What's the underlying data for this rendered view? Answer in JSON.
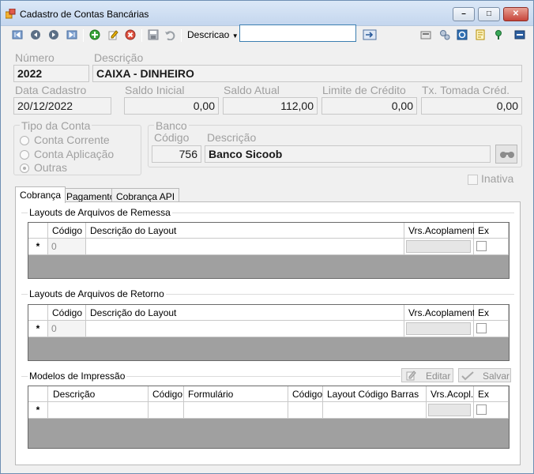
{
  "window": {
    "title": "Cadastro de Contas Bancárias"
  },
  "titlebar_buttons": {
    "minimize": "–",
    "maximize": "□",
    "close": "✕"
  },
  "toolbar": {
    "search_field_label": "Descricao",
    "search_value": "",
    "left_icons": [
      "first-record-icon",
      "previous-record-icon",
      "next-record-icon",
      "last-record-icon",
      "add-icon",
      "edit-icon",
      "delete-icon",
      "save-icon",
      "undo-icon"
    ],
    "right_icons": [
      "search-go-icon",
      "report-icon",
      "settings-icon",
      "refresh-icon",
      "export-icon",
      "pin-icon",
      "exit-icon"
    ]
  },
  "fields": {
    "numero_label": "Número",
    "numero": "2022",
    "descricao_label": "Descrição",
    "descricao": "CAIXA - DINHEIRO",
    "data_cadastro_label": "Data Cadastro",
    "data_cadastro": "20/12/2022",
    "saldo_inicial_label": "Saldo Inicial",
    "saldo_inicial": "0,00",
    "saldo_atual_label": "Saldo Atual",
    "saldo_atual": "112,00",
    "limite_credito_label": "Limite de Crédito",
    "limite_credito": "0,00",
    "tx_tomada_label": "Tx. Tomada Créd.",
    "tx_tomada": "0,00"
  },
  "tipo_conta": {
    "label": "Tipo da Conta",
    "options": [
      "Conta Corrente",
      "Conta Aplicação",
      "Outras"
    ],
    "selected": "Outras"
  },
  "banco": {
    "label": "Banco",
    "codigo_label": "Código",
    "codigo": "756",
    "descricao_label": "Descrição",
    "descricao": "Banco Sicoob"
  },
  "inativa_label": "Inativa",
  "tabs": [
    "Cobrança",
    "Pagamento",
    "Cobrança API"
  ],
  "active_tab": "Cobrança",
  "remessa": {
    "title": "Layouts de Arquivos de Remessa",
    "columns": [
      "Código",
      "Descrição do Layout",
      "Vrs.Acoplamento",
      "Ex"
    ],
    "new_row_marker": "*",
    "new_row_codigo": "0"
  },
  "retorno": {
    "title": "Layouts de Arquivos de Retorno",
    "columns": [
      "Código",
      "Descrição do Layout",
      "Vrs.Acoplamento",
      "Ex"
    ],
    "new_row_marker": "*",
    "new_row_codigo": "0"
  },
  "modelos": {
    "title": "Modelos de Impressão",
    "editar_label": "Editar",
    "salvar_label": "Salvar",
    "columns": [
      "Descrição",
      "Código",
      "Formulário",
      "Código",
      "Layout Código Barras",
      "Vrs.Acopl.",
      "Ex"
    ],
    "new_row_marker": "*"
  }
}
